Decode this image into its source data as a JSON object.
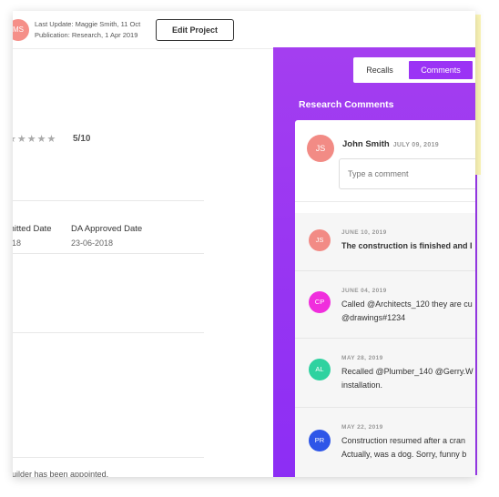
{
  "header": {
    "avatar_initials": "MS",
    "last_update": "Last Update: Maggie Smith, 11 Oct",
    "publication": "Publication: Research, 1 Apr 2019",
    "edit_button": "Edit Project"
  },
  "project": {
    "stars": "★★★★★",
    "rating": "5/10",
    "columns": [
      {
        "header": "mitted Date",
        "value": "018"
      },
      {
        "header": "DA Approved Date",
        "value": "23-06-2018"
      }
    ],
    "footer_text": "builder has been appointed."
  },
  "panel": {
    "tabs": [
      {
        "label": "Recalls"
      },
      {
        "label": "Comments"
      }
    ],
    "active_tab": "Comments",
    "title": "Research Comments",
    "new_comment": {
      "initials": "JS",
      "author": "John Smith",
      "date": "JULY 09, 2019",
      "placeholder": "Type a comment"
    },
    "comments": [
      {
        "initials": "JS",
        "color": "#f28b85",
        "date": "JUNE 10, 2019",
        "line1": "The construction is finished and I",
        "line2": ""
      },
      {
        "initials": "CP",
        "color": "#f02edd",
        "date": "JUNE 04, 2019",
        "line1": "Called @Architects_120 they are cu",
        "line2": "@drawings#1234"
      },
      {
        "initials": "AL",
        "color": "#2fd2a0",
        "date": "MAY 28, 2019",
        "line1": "Recalled @Plumber_140 @Gerry.W",
        "line2": "installation."
      },
      {
        "initials": "PR",
        "color": "#2e56e8",
        "date": "MAY 22, 2019",
        "line1": "Construction resumed after a cran",
        "line2": "Actually, was a dog. Sorry, funny b"
      }
    ]
  },
  "colors": {
    "panel_purple": "#9b33f5",
    "ms_avatar": "#f58f88"
  }
}
